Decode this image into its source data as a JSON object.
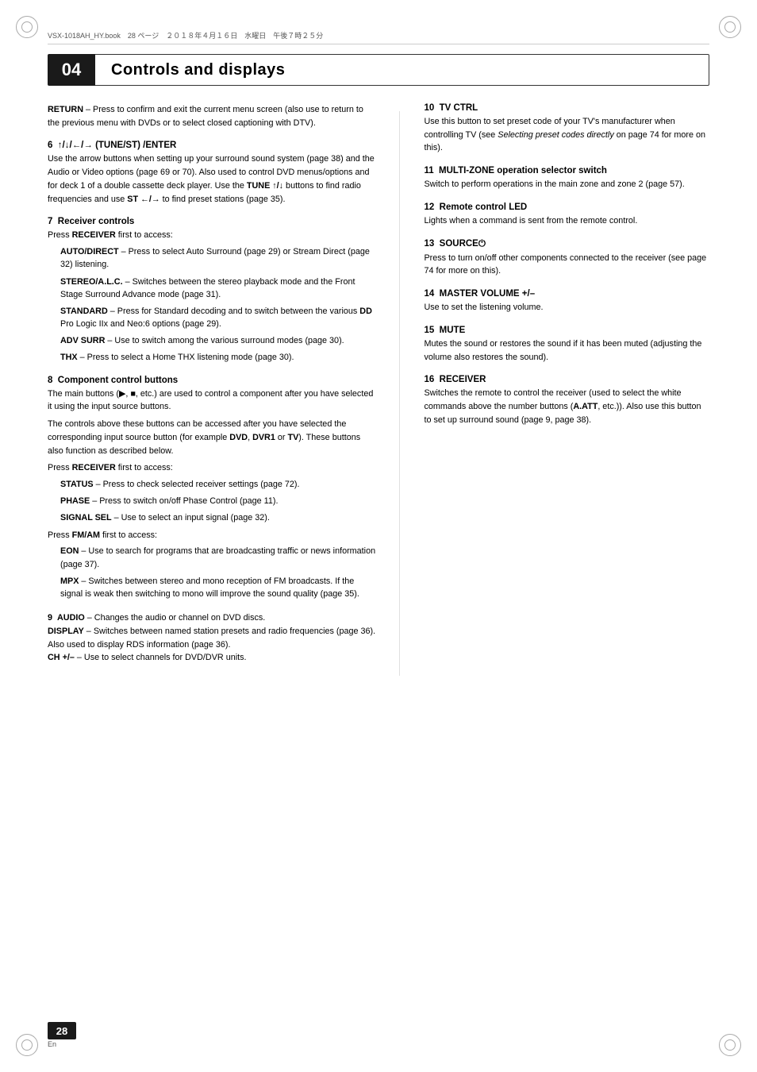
{
  "meta": {
    "file_info": "VSX-1018AH_HY.book　28 ページ　２０１８年４月１６日　水曜日　午後７時２５分"
  },
  "chapter": {
    "number": "04",
    "title": "Controls and displays"
  },
  "page_number": "28",
  "page_lang": "En",
  "left_column": {
    "sections": [
      {
        "id": "return",
        "heading": "",
        "body": "<b>RETURN</b> – Press to confirm and exit the current menu screen (also use to return to the previous menu with DVDs or to select closed captioning with DTV)."
      },
      {
        "id": "6",
        "heading": "6  ↑/↓/←/→ (TUNE/ST) /ENTER",
        "body": "Use the arrow buttons when setting up your surround sound system (page 38) and the Audio or Video options (page 69 or 70). Also used to control DVD menus/options and for deck 1 of a double cassette deck player. Use the <b>TUNE ↑/↓</b> buttons to find radio frequencies and use <b>ST ←/→</b> to find preset stations (page 35)."
      },
      {
        "id": "7",
        "heading": "7  Receiver controls",
        "intro": "Press <b>RECEIVER</b> first to access:",
        "items": [
          "<b>AUTO/DIRECT</b> – Press to select Auto Surround (page 29) or Stream Direct (page 32) listening.",
          "<b>STEREO/A.L.C.</b> – Switches between the stereo playback mode and the Front Stage Surround Advance mode (page 31).",
          "<b>STANDARD</b> – Press for Standard decoding and to switch between the various <b>DD</b> Pro Logic IIx and Neo:6 options (page 29).",
          "<b>ADV SURR</b> – Use to switch among the various surround modes (page 30).",
          "<b>THX</b> – Press to select a Home THX listening mode (page 30)."
        ]
      },
      {
        "id": "8",
        "heading": "8  Component control buttons",
        "body": "The main buttons (▶, ■, etc.) are used to control a component after you have selected it using the input source buttons.",
        "body2": "The controls above these buttons can be accessed after you have selected the corresponding input source button (for example <b>DVD</b>, <b>DVR1</b> or <b>TV</b>). These buttons also function as described below.",
        "intro2": "Press <b>RECEIVER</b> first to access:",
        "items2": [
          "<b>STATUS</b> – Press to check selected receiver settings (page 72).",
          "<b>PHASE</b> – Press to switch on/off Phase Control (page 11).",
          "<b>SIGNAL SEL</b> – Use to select an input signal (page 32)."
        ],
        "intro3": "Press <b>FM/AM</b> first to access:",
        "items3": [
          "<b>EON</b> – Use to search for programs that are broadcasting traffic or news information (page 37).",
          "<b>MPX</b> – Switches between stereo and mono reception of FM broadcasts. If the signal is weak then switching to mono will improve the sound quality (page 35)."
        ]
      },
      {
        "id": "9",
        "heading": "",
        "body": "<b>9  AUDIO</b> – Changes the audio or channel on DVD discs.<br><b>DISPLAY</b> – Switches between named station presets and radio frequencies (page 36). Also used to display RDS information (page 36).<br><b>CH +/–</b> – Use to select channels for DVD/DVR units."
      }
    ]
  },
  "right_column": {
    "sections": [
      {
        "id": "10",
        "heading": "10  TV CTRL",
        "body": "Use this button to set preset code of your TV's manufacturer when controlling TV (see <i>Selecting preset codes directly</i> on page 74 for more on this)."
      },
      {
        "id": "11",
        "heading": "11  MULTI-ZONE operation selector switch",
        "body": "Switch to perform operations in the main zone and zone 2 (page 57)."
      },
      {
        "id": "12",
        "heading": "12  Remote control LED",
        "body": "Lights when a command is sent from the remote control."
      },
      {
        "id": "13",
        "heading": "13  SOURCE⏻",
        "body": "Press to turn on/off other components connected to the receiver (see page 74 for more on this)."
      },
      {
        "id": "14",
        "heading": "14  MASTER VOLUME +/–",
        "body": "Use to set the listening volume."
      },
      {
        "id": "15",
        "heading": "15  MUTE",
        "body": "Mutes the sound or restores the sound if it has been muted (adjusting the volume also restores the sound)."
      },
      {
        "id": "16",
        "heading": "16  RECEIVER",
        "body": "Switches the remote to control the receiver (used to select the white commands above the number buttons (<b>A.ATT</b>, etc.)). Also use this button to set up surround sound (page 9, page 38)."
      }
    ]
  }
}
